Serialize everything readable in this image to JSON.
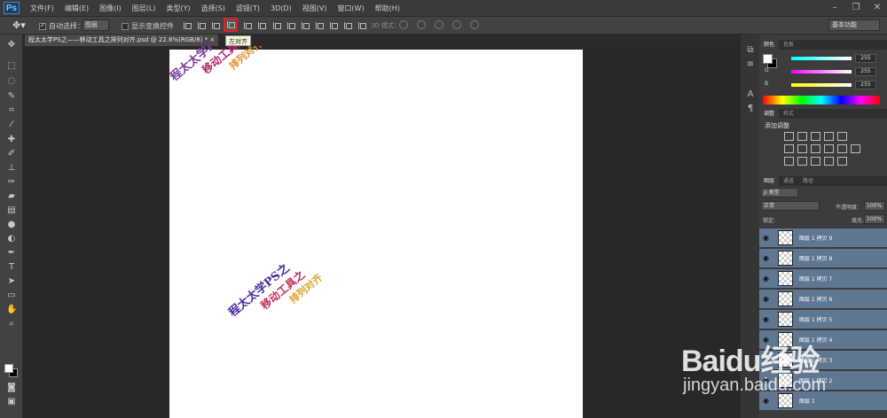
{
  "app": {
    "logo": "Ps"
  },
  "menu": [
    "文件(F)",
    "编辑(E)",
    "图像(I)",
    "图层(L)",
    "类型(Y)",
    "选择(S)",
    "滤镜(T)",
    "3D(D)",
    "视图(V)",
    "窗口(W)",
    "帮助(H)"
  ],
  "options": {
    "auto_select_label": "自动选择：",
    "auto_select_value": "图层",
    "show_transform_label": "显示变换控件",
    "mode_3d": "3D 模式：",
    "workspace": "基本功能",
    "tooltip": "左对齐"
  },
  "document": {
    "tab_title": "程太太学PS之——移动工具之排列对齐.psd @ 22.8%(RGB/8) *",
    "art": [
      {
        "text": "程太太学PS之",
        "color": "#7a3a9e"
      },
      {
        "text": "移动工具之",
        "color": "#b8226a"
      },
      {
        "text": "排列对齐",
        "color": "#e0922a"
      }
    ]
  },
  "panels": {
    "color_tabs": [
      "颜色",
      "色板"
    ],
    "rgb": [
      {
        "label": "R",
        "value": "255"
      },
      {
        "label": "G",
        "value": "255"
      },
      {
        "label": "B",
        "value": "255"
      }
    ],
    "adjust_tabs": [
      "调整",
      "样式"
    ],
    "adjust_title": "添加调整",
    "layer_tabs": [
      "图层",
      "通道",
      "路径"
    ],
    "filter_kind": "ρ 类型",
    "blend_mode": "正常",
    "opacity_label": "不透明度:",
    "opacity_value": "100%",
    "lock_label": "锁定:",
    "fill_label": "填充:",
    "fill_value": "100%",
    "layers": [
      "图层 1 拷贝 9",
      "图层 1 拷贝 8",
      "图层 1 拷贝 7",
      "图层 1 拷贝 6",
      "图层 1 拷贝 5",
      "图层 1 拷贝 4",
      "图层 1 拷贝 3",
      "图层 1 拷贝 2",
      "图层 1"
    ]
  },
  "watermark": {
    "brand": "Baidu经验",
    "url": "jingyan.baidu.com"
  }
}
